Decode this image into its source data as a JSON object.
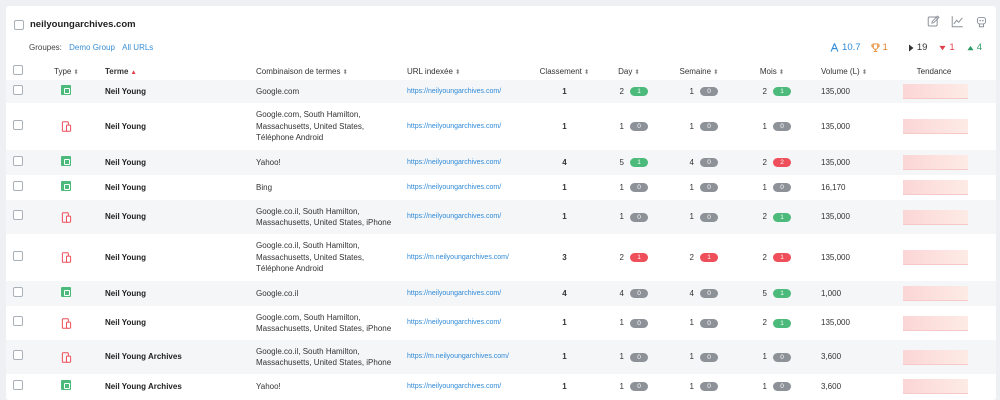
{
  "site": {
    "name": "neilyoungarchives.com"
  },
  "groups": {
    "label": "Groupes:",
    "items": [
      "Demo Group",
      "All URLs"
    ]
  },
  "stats": {
    "avg_position": "10.7",
    "top_count": "1",
    "neutral": "19",
    "down": "1",
    "up": "4"
  },
  "columns": {
    "type": "Type",
    "term": "Terme",
    "combo": "Combinaison de termes",
    "url": "URL indexée",
    "rank": "Classement",
    "day": "Day",
    "week": "Semaine",
    "month": "Mois",
    "volume": "Volume (L)",
    "trend": "Tendance"
  },
  "colors": {
    "accent": "#2f8ad8",
    "up": "#4cba7a",
    "down": "#ee4f5a",
    "neutral": "#8d9198"
  },
  "rows": [
    {
      "type": "desktop",
      "term": "Neil Young",
      "combo": [
        "Google.com"
      ],
      "url": "https://neilyoungarchives.com/",
      "rank": "1",
      "day": {
        "v": "2",
        "d": "1",
        "c": "green"
      },
      "week": {
        "v": "1",
        "d": "0",
        "c": "gray"
      },
      "month": {
        "v": "2",
        "d": "1",
        "c": "green"
      },
      "volume": "135,000"
    },
    {
      "type": "mobile",
      "term": "Neil Young",
      "combo": [
        "Google.com, South Hamilton,",
        "Massachusetts, United States,",
        "Téléphone Android"
      ],
      "url": "https://neilyoungarchives.com/",
      "rank": "1",
      "day": {
        "v": "1",
        "d": "0",
        "c": "gray"
      },
      "week": {
        "v": "1",
        "d": "0",
        "c": "gray"
      },
      "month": {
        "v": "1",
        "d": "0",
        "c": "gray"
      },
      "volume": "135,000"
    },
    {
      "type": "desktop",
      "term": "Neil Young",
      "combo": [
        "Yahoo!"
      ],
      "url": "https://neilyoungarchives.com/",
      "rank": "4",
      "day": {
        "v": "5",
        "d": "1",
        "c": "green"
      },
      "week": {
        "v": "4",
        "d": "0",
        "c": "gray"
      },
      "month": {
        "v": "2",
        "d": "2",
        "c": "red"
      },
      "volume": "135,000"
    },
    {
      "type": "desktop",
      "term": "Neil Young",
      "combo": [
        "Bing"
      ],
      "url": "https://neilyoungarchives.com/",
      "rank": "1",
      "day": {
        "v": "1",
        "d": "0",
        "c": "gray"
      },
      "week": {
        "v": "1",
        "d": "0",
        "c": "gray"
      },
      "month": {
        "v": "1",
        "d": "0",
        "c": "gray"
      },
      "volume": "16,170"
    },
    {
      "type": "mobile",
      "term": "Neil Young",
      "combo": [
        "Google.co.il, South Hamilton,",
        "Massachusetts, United States, iPhone"
      ],
      "url": "https://neilyoungarchives.com/",
      "rank": "1",
      "day": {
        "v": "1",
        "d": "0",
        "c": "gray"
      },
      "week": {
        "v": "1",
        "d": "0",
        "c": "gray"
      },
      "month": {
        "v": "2",
        "d": "1",
        "c": "green"
      },
      "volume": "135,000"
    },
    {
      "type": "mobile",
      "term": "Neil Young",
      "combo": [
        "Google.co.il, South Hamilton,",
        "Massachusetts, United States,",
        "Téléphone Android"
      ],
      "url": "https://m.neilyoungarchives.com/",
      "rank": "3",
      "day": {
        "v": "2",
        "d": "1",
        "c": "red"
      },
      "week": {
        "v": "2",
        "d": "1",
        "c": "red"
      },
      "month": {
        "v": "2",
        "d": "1",
        "c": "red"
      },
      "volume": "135,000"
    },
    {
      "type": "desktop",
      "term": "Neil Young",
      "combo": [
        "Google.co.il"
      ],
      "url": "https://neilyoungarchives.com/",
      "rank": "4",
      "day": {
        "v": "4",
        "d": "0",
        "c": "gray"
      },
      "week": {
        "v": "4",
        "d": "0",
        "c": "gray"
      },
      "month": {
        "v": "5",
        "d": "1",
        "c": "green"
      },
      "volume": "1,000"
    },
    {
      "type": "mobile",
      "term": "Neil Young",
      "combo": [
        "Google.com, South Hamilton,",
        "Massachusetts, United States, iPhone"
      ],
      "url": "https://neilyoungarchives.com/",
      "rank": "1",
      "day": {
        "v": "1",
        "d": "0",
        "c": "gray"
      },
      "week": {
        "v": "1",
        "d": "0",
        "c": "gray"
      },
      "month": {
        "v": "2",
        "d": "1",
        "c": "green"
      },
      "volume": "135,000"
    },
    {
      "type": "mobile",
      "term": "Neil Young Archives",
      "combo": [
        "Google.co.il, South Hamilton,",
        "Massachusetts, United States, iPhone"
      ],
      "url": "https://m.neilyoungarchives.com/",
      "rank": "1",
      "day": {
        "v": "1",
        "d": "0",
        "c": "gray"
      },
      "week": {
        "v": "1",
        "d": "0",
        "c": "gray"
      },
      "month": {
        "v": "1",
        "d": "0",
        "c": "gray"
      },
      "volume": "3,600"
    },
    {
      "type": "desktop",
      "term": "Neil Young Archives",
      "combo": [
        "Yahoo!"
      ],
      "url": "https://neilyoungarchives.com/",
      "rank": "1",
      "day": {
        "v": "1",
        "d": "0",
        "c": "gray"
      },
      "week": {
        "v": "1",
        "d": "0",
        "c": "gray"
      },
      "month": {
        "v": "1",
        "d": "0",
        "c": "gray"
      },
      "volume": "3,600"
    }
  ]
}
